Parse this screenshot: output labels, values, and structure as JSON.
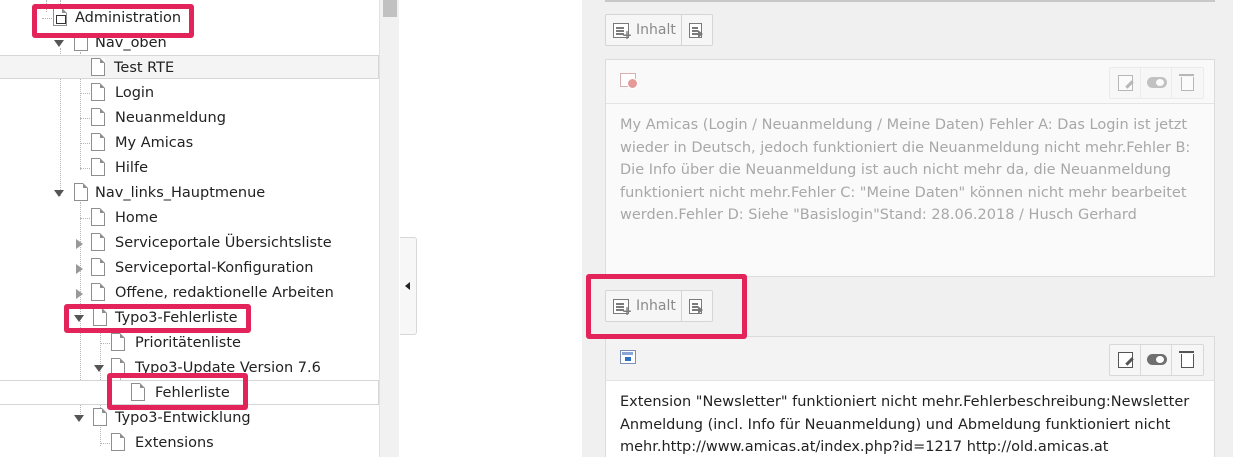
{
  "page_tree": {
    "items": [
      {
        "label": "Administration",
        "icon": "page-shortcut-icon"
      },
      {
        "label": "Nav_oben",
        "icon": "page-icon"
      },
      {
        "label": "Test RTE",
        "icon": "page-icon"
      },
      {
        "label": "Login",
        "icon": "page-icon"
      },
      {
        "label": "Neuanmeldung",
        "icon": "page-icon"
      },
      {
        "label": "My Amicas",
        "icon": "page-icon"
      },
      {
        "label": "Hilfe",
        "icon": "page-icon"
      },
      {
        "label": "Nav_links_Hauptmenue",
        "icon": "page-icon"
      },
      {
        "label": "Home",
        "icon": "page-icon"
      },
      {
        "label": "Serviceportale Übersichtsliste",
        "icon": "page-icon"
      },
      {
        "label": "Serviceportal-Konfiguration",
        "icon": "page-icon"
      },
      {
        "label": "Offene, redaktionelle Arbeiten",
        "icon": "page-icon"
      },
      {
        "label": "Typo3-Fehlerliste",
        "icon": "page-icon"
      },
      {
        "label": "Prioritätenliste",
        "icon": "page-icon"
      },
      {
        "label": "Typo3-Update Version 7.6",
        "icon": "page-icon"
      },
      {
        "label": "Fehlerliste",
        "icon": "page-icon"
      },
      {
        "label": "Typo3-Entwicklung",
        "icon": "page-icon"
      },
      {
        "label": "Extensions",
        "icon": "page-icon"
      }
    ]
  },
  "content": {
    "new_content_label": "Inhalt",
    "new_content_icon": "new-content-icon",
    "paste_icon": "paste-icon",
    "elements": [
      {
        "hidden": true,
        "type_icon": "hidden-content-icon",
        "text": "My Amicas (Login / Neuanmeldung / Meine Daten) Fehler A: Das Login ist jetzt wieder in Deutsch, jedoch funktioniert die Neuanmeldung nicht mehr.Fehler B: Die Info über die Neuanmeldung ist auch nicht mehr da, die Neuanmeldung funktioniert nicht mehr.Fehler C: \"Meine Daten\" können nicht mehr bearbeitet werden.Fehler D: Siehe \"Basislogin\"Stand: 28.06.2018 / Husch Gerhard"
      },
      {
        "hidden": false,
        "type_icon": "text-content-icon",
        "text": "Extension \"Newsletter\" funktioniert nicht mehr.Fehlerbeschreibung:Newsletter Anmeldung (incl. Info für Neuanmeldung) und Abmeldung funktioniert nicht mehr.http://www.amicas.at/index.php?id=1217 http://old.amicas.at"
      }
    ],
    "actions": {
      "edit_icon": "edit-icon",
      "toggle_icon": "visibility-toggle-icon",
      "delete_icon": "trash-icon"
    }
  },
  "annotation_color": "#e3245a"
}
